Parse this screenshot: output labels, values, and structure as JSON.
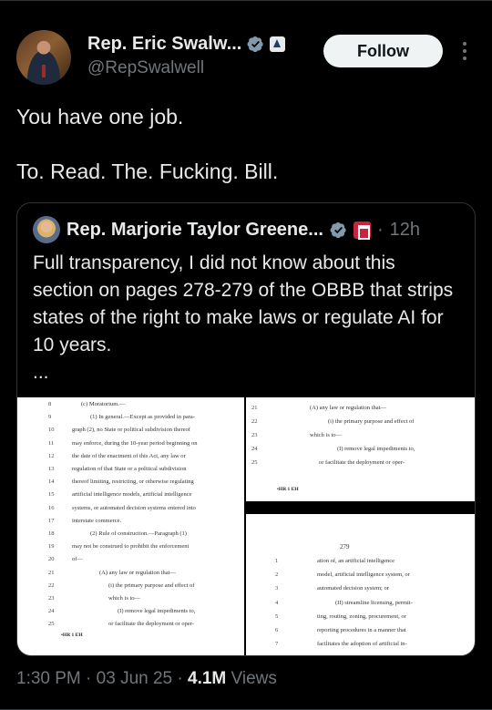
{
  "author": {
    "name": "Rep. Eric Swalw...",
    "handle": "@RepSwalwell",
    "follow_label": "Follow"
  },
  "tweet": {
    "lines": [
      "You have one job.",
      "To. Read. The. Fucking. Bill."
    ]
  },
  "quote": {
    "name": "Rep. Marjorie Taylor Greene...",
    "time": "12h",
    "separator": "·",
    "text": "Full transparency, I did not know about this section on pages 278-279 of the OBBB that strips states of the right to make laws or regulate AI for 10 years.",
    "ellipsis": "...",
    "doc_left": {
      "line_numbers": [
        "8",
        "9",
        "10",
        "11",
        "12",
        "13",
        "14",
        "15",
        "16",
        "17",
        "18",
        "19",
        "20",
        "21",
        "22",
        "23",
        "24",
        "25"
      ],
      "lines": [
        "(c) Moratorium.—",
        "(1) In general.—Except as provided in para-",
        "graph (2), no State or political subdivision thereof",
        "may enforce, during the 10-year period beginning on",
        "the date of the enactment of this Act, any law or",
        "regulation of that State or a political subdivision",
        "thereof limiting, restricting, or otherwise regulating",
        "artificial intelligence models, artificial intelligence",
        "systems, or automated decision systems entered into",
        "interstate commerce.",
        "(2) Rule of construction.—Paragraph (1)",
        "may not be construed to prohibit the enforcement",
        "of—",
        "(A) any law or regulation that—",
        "(i) the primary purpose and effect of",
        "which is to—",
        "(I) remove legal impediments to,",
        "or facilitate the deployment or oper-"
      ],
      "footer": "•HR 1 EH"
    },
    "doc_right_top": {
      "line_numbers": [
        "21",
        "22",
        "23",
        "24",
        "25"
      ],
      "lines": [
        "(A) any law or regulation that—",
        "(i) the primary purpose and effect of",
        "which is to—",
        "(I) remove legal impediments to,",
        "or facilitate the deployment or oper-"
      ],
      "footer": "•HR 1 EH"
    },
    "doc_right_bottom": {
      "page_number": "279",
      "line_numbers": [
        "1",
        "2",
        "3",
        "4",
        "5",
        "6",
        "7"
      ],
      "lines": [
        "ation of, an artificial intelligence",
        "model, artificial intelligence system, or",
        "automated decision system; or",
        "(II) streamline licensing, permit-",
        "ting, routing, zoning, procurement, or",
        "reporting procedures in a manner that",
        "facilitates the adoption of artificial in-"
      ]
    }
  },
  "meta": {
    "time": "1:30 PM",
    "date": "03 Jun 25",
    "sep": "·",
    "views_count": "4.1M",
    "views_label": "Views"
  },
  "colors": {
    "background": "#000000",
    "text": "#e7e9ea",
    "muted": "#71767b",
    "verified": "#829aab",
    "border": "#2f3336"
  },
  "icons": [
    "verified-badge-icon",
    "government-badge-icon",
    "more-options-icon",
    "house-badge-icon"
  ]
}
